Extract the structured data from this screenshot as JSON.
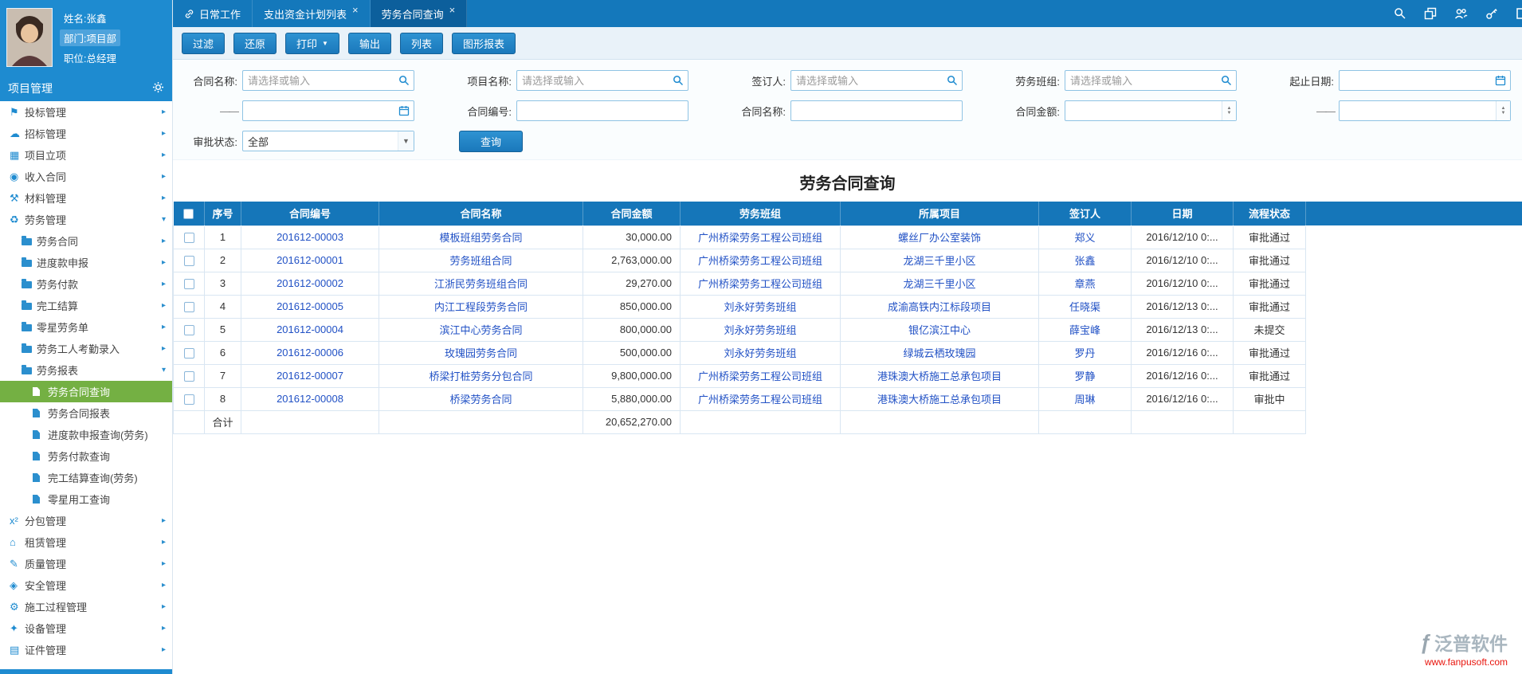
{
  "user": {
    "name": "姓名:张鑫",
    "dept": "部门:项目部",
    "title": "职位:总经理"
  },
  "topbar": {
    "tabs": [
      {
        "label": "日常工作",
        "icon": "link",
        "closable": false,
        "active": false
      },
      {
        "label": "支出资金计划列表",
        "closable": true,
        "active": false
      },
      {
        "label": "劳务合同查询",
        "closable": true,
        "active": true
      }
    ]
  },
  "sidebar": {
    "header": "项目管理",
    "items": [
      {
        "label": "投标管理",
        "level": 0,
        "icon": "flag",
        "arrow": "right"
      },
      {
        "label": "招标管理",
        "level": 0,
        "icon": "cloud",
        "arrow": "right"
      },
      {
        "label": "项目立项",
        "level": 0,
        "icon": "grid",
        "arrow": "right"
      },
      {
        "label": "收入合同",
        "level": 0,
        "icon": "income",
        "arrow": "right"
      },
      {
        "label": "材料管理",
        "level": 0,
        "icon": "material",
        "arrow": "right"
      },
      {
        "label": "劳务管理",
        "level": 0,
        "icon": "labor",
        "arrow": "down"
      },
      {
        "label": "劳务合同",
        "level": 1,
        "icon": "folder",
        "arrow": "right"
      },
      {
        "label": "进度款申报",
        "level": 1,
        "icon": "folder",
        "arrow": "right"
      },
      {
        "label": "劳务付款",
        "level": 1,
        "icon": "folder",
        "arrow": "right"
      },
      {
        "label": "完工结算",
        "level": 1,
        "icon": "folder",
        "arrow": "right"
      },
      {
        "label": "零星劳务单",
        "level": 1,
        "icon": "folder",
        "arrow": "right"
      },
      {
        "label": "劳务工人考勤录入",
        "level": 1,
        "icon": "folder",
        "arrow": "right"
      },
      {
        "label": "劳务报表",
        "level": 1,
        "icon": "folder",
        "arrow": "down"
      },
      {
        "label": "劳务合同查询",
        "level": 2,
        "icon": "doc",
        "active": true
      },
      {
        "label": "劳务合同报表",
        "level": 2,
        "icon": "doc"
      },
      {
        "label": "进度款申报查询(劳务)",
        "level": 2,
        "icon": "doc"
      },
      {
        "label": "劳务付款查询",
        "level": 2,
        "icon": "doc"
      },
      {
        "label": "完工结算查询(劳务)",
        "level": 2,
        "icon": "doc"
      },
      {
        "label": "零星用工查询",
        "level": 2,
        "icon": "doc"
      },
      {
        "label": "分包管理",
        "level": 0,
        "icon": "x2",
        "arrow": "right"
      },
      {
        "label": "租赁管理",
        "level": 0,
        "icon": "lease",
        "arrow": "right"
      },
      {
        "label": "质量管理",
        "level": 0,
        "icon": "quality",
        "arrow": "right"
      },
      {
        "label": "安全管理",
        "level": 0,
        "icon": "safety",
        "arrow": "right"
      },
      {
        "label": "施工过程管理",
        "level": 0,
        "icon": "process",
        "arrow": "right"
      },
      {
        "label": "设备管理",
        "level": 0,
        "icon": "equipment",
        "arrow": "right"
      },
      {
        "label": "证件管理",
        "level": 0,
        "icon": "cert",
        "arrow": "right"
      }
    ]
  },
  "toolbar": {
    "buttons": [
      {
        "label": "过滤"
      },
      {
        "label": "还原"
      },
      {
        "label": "打印",
        "dropdown": true
      },
      {
        "label": "输出"
      },
      {
        "label": "列表"
      },
      {
        "label": "图形报表"
      }
    ]
  },
  "filters": {
    "contract_name": {
      "label": "合同名称:",
      "placeholder": "请选择或输入"
    },
    "project_name": {
      "label": "项目名称:",
      "placeholder": "请选择或输入"
    },
    "signer": {
      "label": "签订人:",
      "placeholder": "请选择或输入"
    },
    "labor_team": {
      "label": "劳务班组:",
      "placeholder": "请选择或输入"
    },
    "date_start": {
      "label": "起止日期:"
    },
    "range_dash": "——",
    "contract_no": {
      "label": "合同编号:"
    },
    "contract_name2": {
      "label": "合同名称:"
    },
    "contract_amount": {
      "label": "合同金额:"
    },
    "approval_status": {
      "label": "审批状态:",
      "value": "全部"
    },
    "query_button": "查询"
  },
  "page_title": "劳务合同查询",
  "table": {
    "headers": [
      "序号",
      "合同编号",
      "合同名称",
      "合同金额",
      "劳务班组",
      "所属项目",
      "签订人",
      "日期",
      "流程状态"
    ],
    "rows": [
      {
        "no": "1",
        "code": "201612-00003",
        "name": "模板班组劳务合同",
        "amount": "30,000.00",
        "team": "广州桥梁劳务工程公司班组",
        "project": "螺丝厂办公室装饰",
        "signer": "郑义",
        "date": "2016/12/10 0:...",
        "status": "审批通过"
      },
      {
        "no": "2",
        "code": "201612-00001",
        "name": "劳务班组合同",
        "amount": "2,763,000.00",
        "team": "广州桥梁劳务工程公司班组",
        "project": "龙湖三千里小区",
        "signer": "张鑫",
        "date": "2016/12/10 0:...",
        "status": "审批通过"
      },
      {
        "no": "3",
        "code": "201612-00002",
        "name": "江浙民劳务班组合同",
        "amount": "29,270.00",
        "team": "广州桥梁劳务工程公司班组",
        "project": "龙湖三千里小区",
        "signer": "章燕",
        "date": "2016/12/10 0:...",
        "status": "审批通过"
      },
      {
        "no": "4",
        "code": "201612-00005",
        "name": "内江工程段劳务合同",
        "amount": "850,000.00",
        "team": "刘永好劳务班组",
        "project": "成渝高铁内江标段项目",
        "signer": "任晓渠",
        "date": "2016/12/13 0:...",
        "status": "审批通过"
      },
      {
        "no": "5",
        "code": "201612-00004",
        "name": "滨江中心劳务合同",
        "amount": "800,000.00",
        "team": "刘永好劳务班组",
        "project": "银亿滨江中心",
        "signer": "薛宝峰",
        "date": "2016/12/13 0:...",
        "status": "未提交"
      },
      {
        "no": "6",
        "code": "201612-00006",
        "name": "玫瑰园劳务合同",
        "amount": "500,000.00",
        "team": "刘永好劳务班组",
        "project": "绿城云栖玫瑰园",
        "signer": "罗丹",
        "date": "2016/12/16 0:...",
        "status": "审批通过"
      },
      {
        "no": "7",
        "code": "201612-00007",
        "name": "桥梁打桩劳务分包合同",
        "amount": "9,800,000.00",
        "team": "广州桥梁劳务工程公司班组",
        "project": "港珠澳大桥施工总承包项目",
        "signer": "罗静",
        "date": "2016/12/16 0:...",
        "status": "审批通过"
      },
      {
        "no": "8",
        "code": "201612-00008",
        "name": "桥梁劳务合同",
        "amount": "5,880,000.00",
        "team": "广州桥梁劳务工程公司班组",
        "project": "港珠澳大桥施工总承包项目",
        "signer": "周琳",
        "date": "2016/12/16 0:...",
        "status": "审批中"
      }
    ],
    "total": {
      "label": "合计",
      "amount": "20,652,270.00"
    }
  },
  "watermark": {
    "brand": "泛普软件",
    "url": "www.fanpusoft.com"
  },
  "colors": {
    "topbar": "#1478bb",
    "panel_blue": "#1e8bd0",
    "active_green": "#74b043",
    "table_header": "#1576b9",
    "link": "#2151c5",
    "brand_red": "#e8140c"
  }
}
